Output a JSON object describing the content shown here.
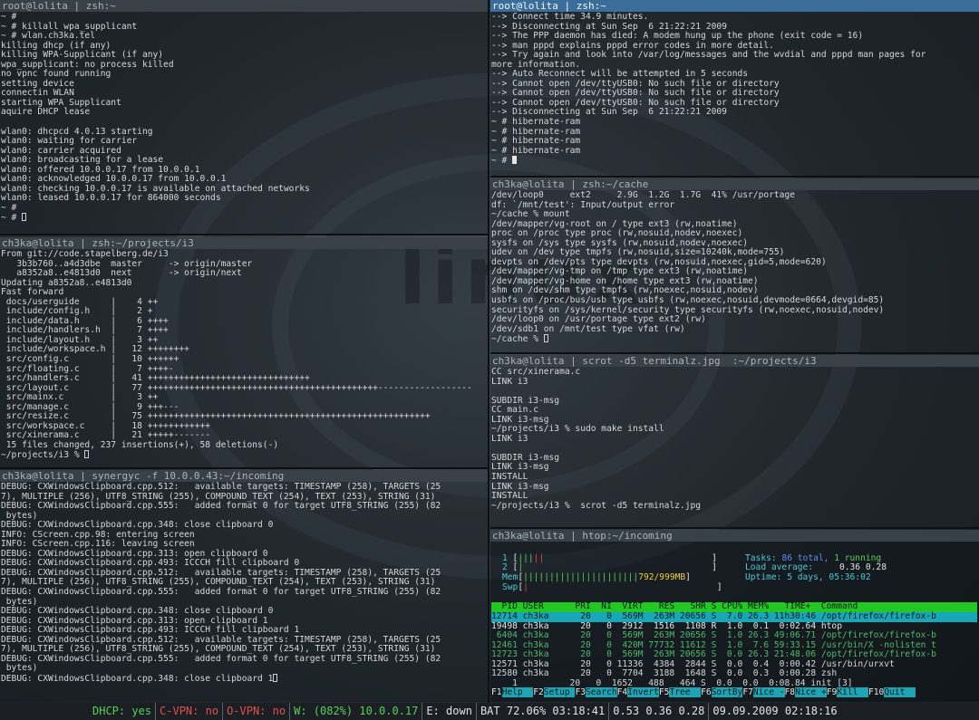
{
  "panes": {
    "root_top": {
      "title": "root@lolita | zsh:~",
      "lines": [
        "~ #",
        "~ # killall wpa_supplicant",
        "~ # wlan.ch3ka.tel",
        "killing dhcp (if any)",
        "killing WPA-Supplicant (if any)",
        "wpa_supplicant: no process killed",
        "no vpnc found running",
        "setting device",
        "connectin WLAN",
        "starting WPA Supplicant",
        "aquire DHCP lease",
        "",
        "wlan0: dhcpcd 4.0.13 starting",
        "wlan0: waiting for carrier",
        "wlan0: carrier acquired",
        "wlan0: broadcasting for a lease",
        "wlan0: offered 10.0.0.17 from 10.0.0.1",
        "wlan0: acknowledged 10.0.0.17 from 10.0.0.1",
        "wlan0: checking 10.0.0.17 is available on attached networks",
        "wlan0: leased 10.0.0.17 for 864000 seconds",
        "~ #",
        "~ # "
      ]
    },
    "root_right": {
      "title": "root@lolita | zsh:~",
      "lines": [
        "--> Connect time 34.9 minutes.",
        "--> Disconnecting at Sun Sep  6 21:22:21 2009",
        "--> The PPP daemon has died: A modem hung up the phone (exit code = 16)",
        "--> man pppd explains pppd error codes in more detail.",
        "--> Try again and look into /var/log/messages and the wvdial and pppd man pages for",
        "more information.",
        "--> Auto Reconnect will be attempted in 5 seconds",
        "--> Cannot open /dev/ttyUSB0: No such file or directory",
        "--> Cannot open /dev/ttyUSB0: No such file or directory",
        "--> Cannot open /dev/ttyUSB0: No such file or directory",
        "--> Disconnecting at Sun Sep  6 21:22:21 2009",
        "~ # hibernate-ram",
        "~ # hibernate-ram",
        "~ # hibernate-ram",
        "~ # hibernate-ram",
        "~ # "
      ]
    },
    "projects": {
      "title": "ch3ka@lolita | zsh:~/projects/i3",
      "lines": [
        "From git://code.stapelberg.de/i3",
        "   3b3b760..a4d3dbe  master     -> origin/master",
        "   a8352a8..e4813d0  next       -> origin/next",
        "Updating a8352a8..e4813d0",
        "Fast forward",
        " docs/userguide      |    4 ++",
        " include/config.h    |    2 +",
        " include/data.h      |    6 ++++",
        " include/handlers.h  |    7 ++++",
        " include/layout.h    |    3 ++",
        " include/workspace.h |   12 ++++++++",
        " src/config.c        |   10 ++++++",
        " src/floating.c      |    7 ++++-",
        " src/handlers.c      |   41 +++++++++++++++++++++++++++++++",
        " src/layout.c        |   77 ++++++++++++++++++++++++++++++++++++++++++++------------------",
        " src/mainx.c         |    3 ++",
        " src/manage.c        |    9 +++---",
        " src/resize.c        |   75 ++++++++++++++++++++++++++++++++++++++++++++++++++++++",
        " src/workspace.c     |   18 ++++++++++++",
        " src/xinerama.c      |   21 +++++-------",
        " 15 files changed, 237 insertions(+), 58 deletions(-)",
        "~/projects/i3 % "
      ]
    },
    "cache": {
      "title": "ch3ka@lolita | zsh:~/cache",
      "lines": [
        "/dev/loop0     ext2     2.9G  1.2G  1.7G  41% /usr/portage",
        "df: `/mnt/test': Input/output error",
        "~/cache % mount",
        "/dev/mapper/vg-root on / type ext3 (rw,noatime)",
        "proc on /proc type proc (rw,nosuid,nodev,noexec)",
        "sysfs on /sys type sysfs (rw,nosuid,nodev,noexec)",
        "udev on /dev type tmpfs (rw,nosuid,size=10240k,mode=755)",
        "devpts on /dev/pts type devpts (rw,nosuid,noexec,gid=5,mode=620)",
        "/dev/mapper/vg-tmp on /tmp type ext3 (rw,noatime)",
        "/dev/mapper/vg-home on /home type ext3 (rw,noatime)",
        "shm on /dev/shm type tmpfs (rw,noexec,nosuid,nodev)",
        "usbfs on /proc/bus/usb type usbfs (rw,noexec,nosuid,devmode=0664,devgid=85)",
        "securityfs on /sys/kernel/security type securityfs (rw,noexec,nosuid,nodev)",
        "/dev/loop0 on /usr/portage type ext2 (rw)",
        "/dev/sdb1 on /mnt/test type vfat (rw)",
        "~/cache % "
      ]
    },
    "scrot": {
      "title": "ch3ka@lolita | scrot -d5 terminalz.jpg  :~/projects/i3",
      "lines": [
        "CC src/xinerama.c",
        "LINK i3",
        "",
        "SUBDIR i3-msg",
        "CC main.c",
        "LINK i3-msg",
        "~/projects/i3 % sudo make install",
        "LINK i3",
        "",
        "SUBDIR i3-msg",
        "LINK i3-msg",
        "INSTALL",
        "LINK i3-msg",
        "INSTALL",
        "~/projects/i3 %  scrot -d5 terminalz.jpg"
      ]
    },
    "synergy": {
      "title": "ch3ka@lolita | synergyc -f 10.0.0.43:~/incoming",
      "lines": [
        "DEBUG: CXWindowsClipboard.cpp.512:   available targets: TIMESTAMP (258), TARGETS (25",
        "7), MULTIPLE (256), UTF8_STRING (255), COMPOUND_TEXT (254), TEXT (253), STRING (31)",
        "DEBUG: CXWindowsClipboard.cpp.555:   added format 0 for target UTF8_STRING (255) (82",
        " bytes)",
        "DEBUG: CXWindowsClipboard.cpp.348: close clipboard 0",
        "INFO: CScreen.cpp.98: entering screen",
        "INFO: CScreen.cpp.116: leaving screen",
        "DEBUG: CXWindowsClipboard.cpp.313: open clipboard 0",
        "DEBUG: CXWindowsClipboard.cpp.493: ICCCH fill clipboard 0",
        "DEBUG: CXWindowsClipboard.cpp.512:   available targets: TIMESTAMP (258), TARGETS (25",
        "7), MULTIPLE (256), UTF8_STRING (255), COMPOUND_TEXT (254), TEXT (253), STRING (31)",
        "DEBUG: CXWindowsClipboard.cpp.555:   added format 0 for target UTF8_STRING (255) (82",
        " bytes)",
        "DEBUG: CXWindowsClipboard.cpp.348: close clipboard 0",
        "DEBUG: CXWindowsClipboard.cpp.313: open clipboard 1",
        "DEBUG: CXWindowsClipboard.cpp.493: ICCCH fill clipboard 1",
        "DEBUG: CXWindowsClipboard.cpp.512:   available targets: TIMESTAMP (258), TARGETS (25",
        "7), MULTIPLE (256), UTF8_STRING (255), COMPOUND_TEXT (254), TEXT (253), STRING (31)",
        "DEBUG: CXWindowsClipboard.cpp.555:   added format 0 for target UTF8_STRING (255) (82",
        " bytes)",
        "DEBUG: CXWindowsClipboard.cpp.348: close clipboard 1"
      ]
    }
  },
  "htop": {
    "title": "ch3ka@lolita | htop:~/incoming",
    "cpu1_label": "1",
    "cpu2_label": "2",
    "mem_label": "Mem",
    "swp_label": "Swp",
    "mem_value": "792/999MB",
    "tasks_label": "Tasks:",
    "tasks_value": "86 total,",
    "running_value": "1 running",
    "load_label": "Load average:",
    "load_value": "0.36 0.28",
    "uptime_label": "Uptime:",
    "uptime_value": "5 days, 05:36:02",
    "header": "  PID USER      PRI  NI  VIRT   RES   SHR S CPU% MEM%   TIME+  Command",
    "rows": [
      "12714 ch3ka      20   0  569M  263M 20656 S  7.0 26.3 11h30:46 /opt/firefox/firefox-b",
      "19498 ch3ka      20   0  2912  1516  1108 R  1.0  0.1  0:02.64 htop",
      " 6404 ch3ka      20   0  569M  263M 20656 S  1.0 26.3 49:06.71 /opt/firefox/firefox-b",
      "12461 ch3ka      20   0  420M 77732 11612 S  1.0  7.6 59:33.15 /usr/bin/X -nolisten t",
      "12723 ch3ka      20   0  569M  263M 20656 S  0.0 26.3 21:48.06 /opt/firefox/firefox-b",
      "12571 ch3ka      20   0 11336  4384  2844 S  0.0  0.4  0:00.42 /usr/bin/urxvt",
      "12580 ch3ka      20   0  7704  3188  1648 S  0.0  0.3  0:00.28 zsh",
      "    1          20   0  1652   488   464 S  0.0  0.0  0:08.84 init [3]"
    ],
    "fkeys": [
      {
        "key": "F1",
        "label": "Help  "
      },
      {
        "key": "F2",
        "label": "Setup "
      },
      {
        "key": "F3",
        "label": "Search"
      },
      {
        "key": "F4",
        "label": "Invert"
      },
      {
        "key": "F5",
        "label": "Tree  "
      },
      {
        "key": "F6",
        "label": "SortBy"
      },
      {
        "key": "F7",
        "label": "Nice -"
      },
      {
        "key": "F8",
        "label": "Nice +"
      },
      {
        "key": "F9",
        "label": "Kill  "
      },
      {
        "key": "F10",
        "label": "Quit  "
      }
    ]
  },
  "statusbar": {
    "dhcp": "DHCP: yes",
    "cvpn": "C-VPN: no",
    "ovpn": "O-VPN: no",
    "wlan": "W: (082%) 10.0.0.17",
    "eth": "E: down",
    "bat": "BAT 72.06% 03:18:41",
    "load": "0.53 0.36 0.28",
    "clock": "09.09.2009 02:18:16"
  },
  "wallpaper_text": "linux",
  "colors": {
    "active_title": "#3a6d99",
    "inactive_title": "#394148",
    "htop_green": "#24c824",
    "htop_cyan": "#17a7b7",
    "status_green": "#58d058",
    "status_red": "#e25050"
  }
}
